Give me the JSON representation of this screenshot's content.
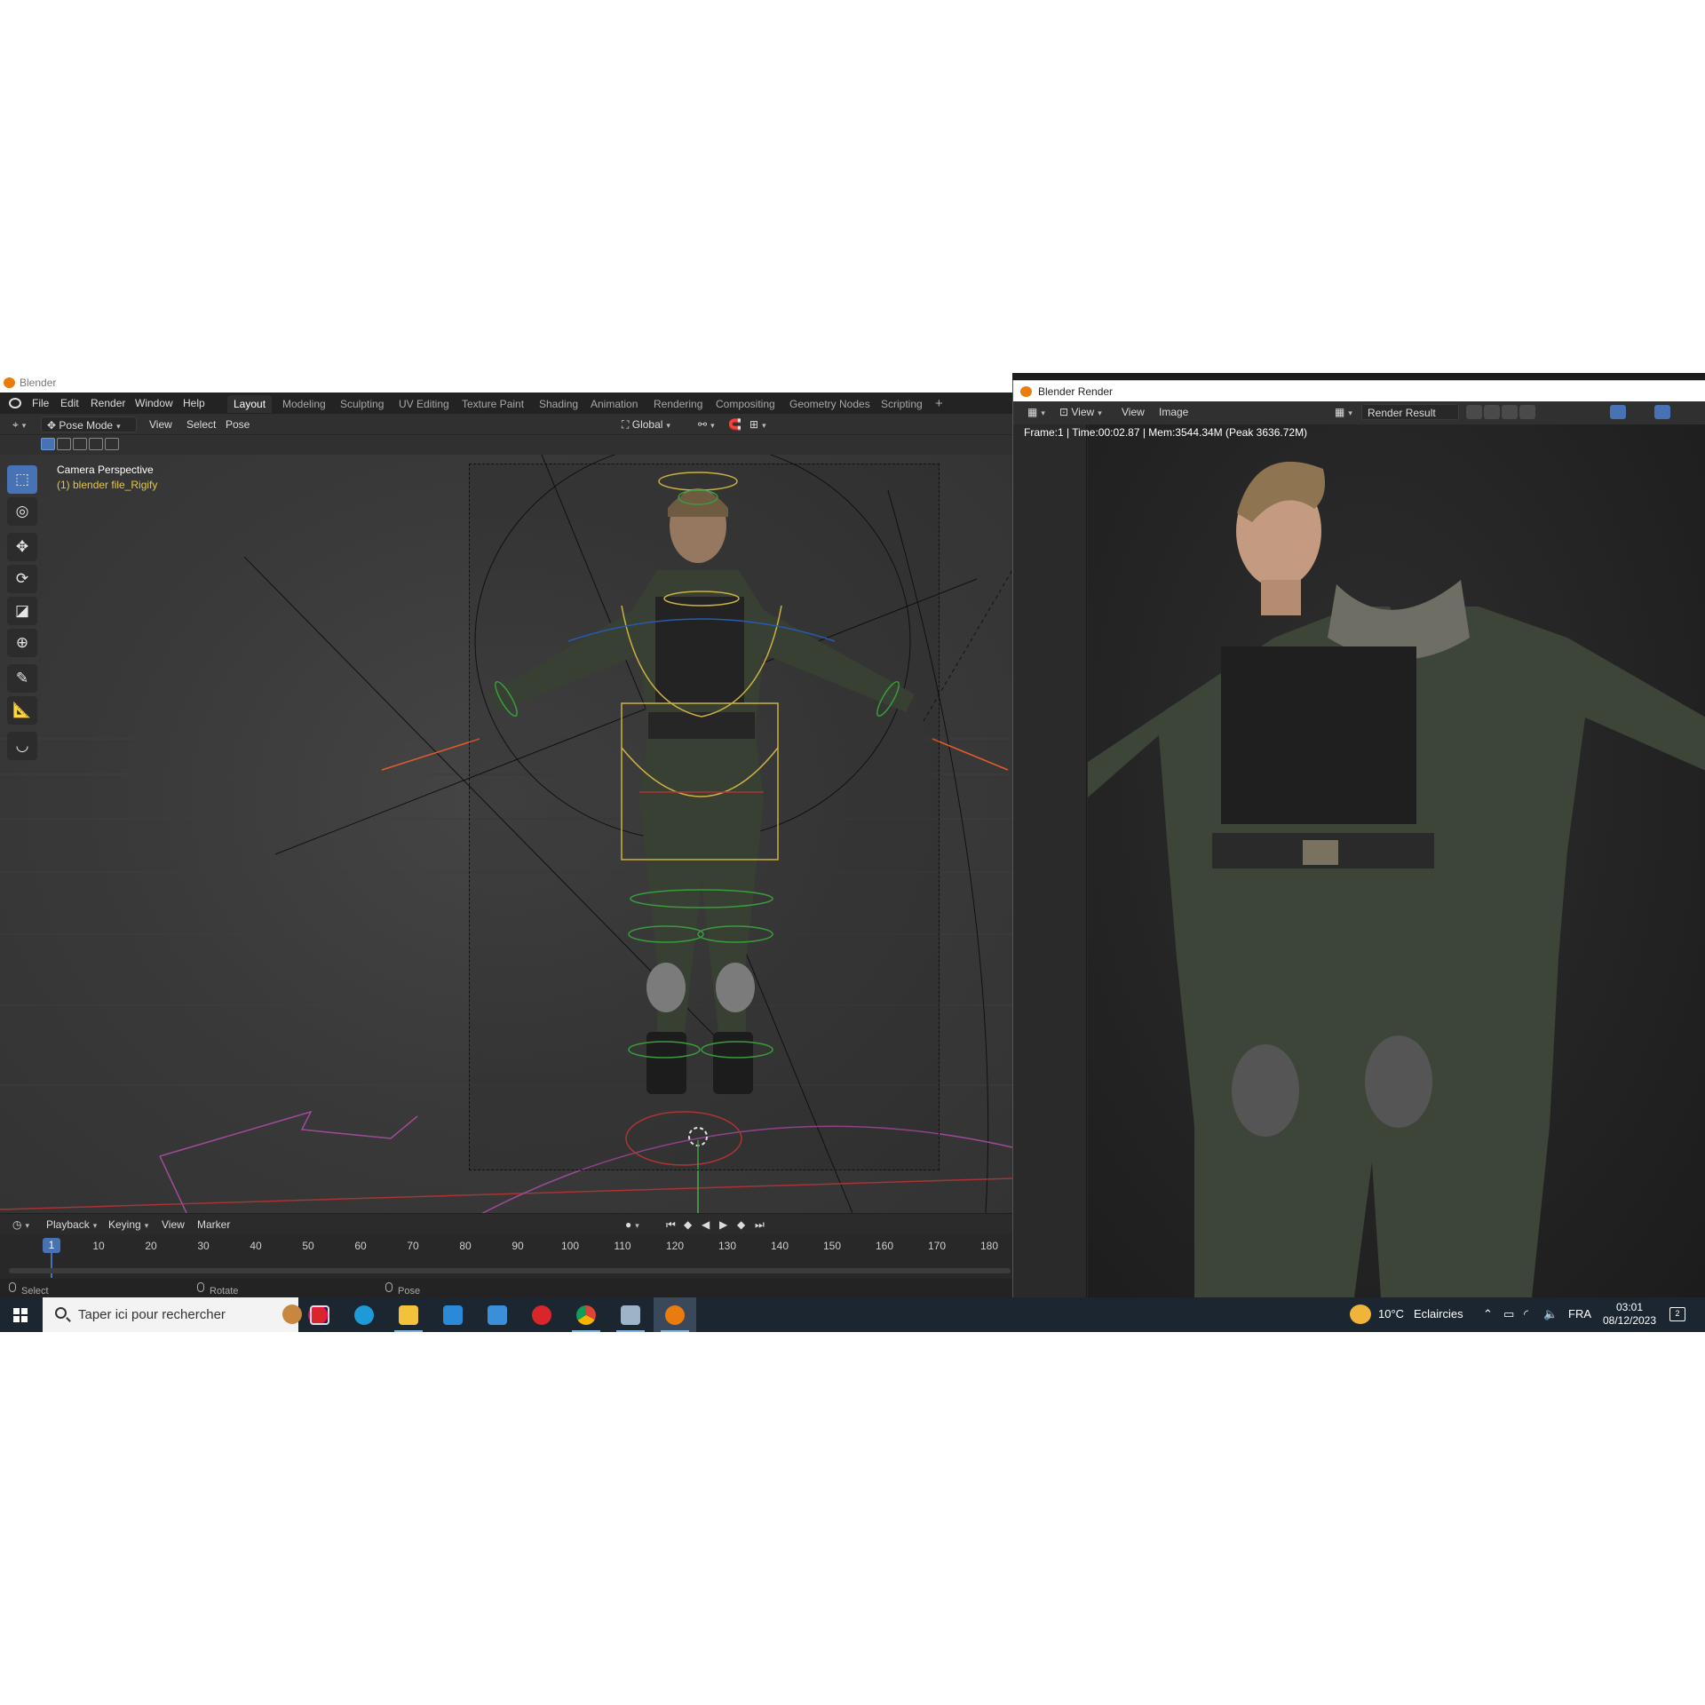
{
  "main_window": {
    "os_title": "Blender",
    "menu": [
      "File",
      "Edit",
      "Render",
      "Window",
      "Help"
    ],
    "workspaces": [
      "Layout",
      "Modeling",
      "Sculpting",
      "UV Editing",
      "Texture Paint",
      "Shading",
      "Animation",
      "Rendering",
      "Compositing",
      "Geometry Nodes",
      "Scripting"
    ],
    "add_workspace": "+",
    "header": {
      "mode": "Pose Mode",
      "view": "View",
      "select": "Select",
      "pose": "Pose",
      "orientation": "Global"
    },
    "viewport": {
      "camera_label": "Camera Perspective",
      "object_label": "(1) blender file_Rigify",
      "tools": [
        "select-box",
        "cursor",
        "move",
        "rotate",
        "scale",
        "transform",
        "annotate",
        "measure",
        "pose-relax"
      ]
    },
    "timeline": {
      "playback": "Playback",
      "keying": "Keying",
      "view": "View",
      "marker": "Marker",
      "current_frame": "1",
      "frame_labels": [
        "10",
        "20",
        "30",
        "40",
        "50",
        "60",
        "70",
        "80",
        "90",
        "100",
        "110",
        "120",
        "130",
        "140",
        "150",
        "160",
        "170",
        "180"
      ]
    },
    "status": {
      "select": "Select",
      "rotate": "Rotate View",
      "context": "Pose Context Menu"
    }
  },
  "render_window": {
    "title": "Blender Render",
    "view1": "View",
    "view2": "View",
    "image": "Image",
    "slot": "Render Result",
    "info": "Frame:1 | Time:00:02.87 | Mem:3544.34M (Peak 3636.72M)"
  },
  "taskbar": {
    "search_placeholder": "Taper ici pour rechercher",
    "weather_temp": "10°C",
    "weather_desc": "Eclaircies",
    "language": "FRA",
    "time": "03:01",
    "date": "08/12/2023",
    "notifications": "2",
    "apps": [
      "task-view",
      "edge",
      "file-explorer",
      "store",
      "mail",
      "opera",
      "chrome",
      "photos",
      "blender"
    ]
  },
  "colors": {
    "accent": "#4772b3",
    "blender_orange": "#e87d0d",
    "object_label": "#e6c84b",
    "taskbar": "#1b2630"
  }
}
